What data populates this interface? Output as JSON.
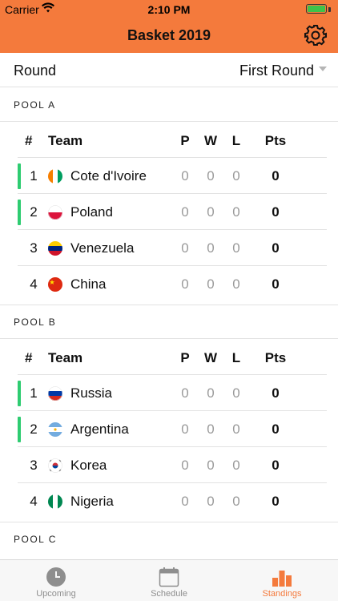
{
  "status_bar": {
    "carrier": "Carrier",
    "time": "2:10 PM",
    "battery_level": 1.0
  },
  "app": {
    "title": "Basket 2019"
  },
  "round": {
    "label": "Round",
    "value": "First Round"
  },
  "table_headers": {
    "rank": "#",
    "team": "Team",
    "played": "P",
    "won": "W",
    "lost": "L",
    "points": "Pts"
  },
  "pools": [
    {
      "name": "POOL A",
      "teams": [
        {
          "rank": "1",
          "name": "Cote d'Ivoire",
          "p": "0",
          "w": "0",
          "l": "0",
          "pts": "0",
          "qualified": true
        },
        {
          "rank": "2",
          "name": "Poland",
          "p": "0",
          "w": "0",
          "l": "0",
          "pts": "0",
          "qualified": true
        },
        {
          "rank": "3",
          "name": "Venezuela",
          "p": "0",
          "w": "0",
          "l": "0",
          "pts": "0",
          "qualified": false
        },
        {
          "rank": "4",
          "name": "China",
          "p": "0",
          "w": "0",
          "l": "0",
          "pts": "0",
          "qualified": false
        }
      ]
    },
    {
      "name": "POOL B",
      "teams": [
        {
          "rank": "1",
          "name": "Russia",
          "p": "0",
          "w": "0",
          "l": "0",
          "pts": "0",
          "qualified": true
        },
        {
          "rank": "2",
          "name": "Argentina",
          "p": "0",
          "w": "0",
          "l": "0",
          "pts": "0",
          "qualified": true
        },
        {
          "rank": "3",
          "name": "Korea",
          "p": "0",
          "w": "0",
          "l": "0",
          "pts": "0",
          "qualified": false
        },
        {
          "rank": "4",
          "name": "Nigeria",
          "p": "0",
          "w": "0",
          "l": "0",
          "pts": "0",
          "qualified": false
        }
      ]
    },
    {
      "name": "POOL C",
      "teams": []
    }
  ],
  "tabs": [
    {
      "label": "Upcoming",
      "icon": "clock-icon",
      "active": false
    },
    {
      "label": "Schedule",
      "icon": "calendar-icon",
      "active": false
    },
    {
      "label": "Standings",
      "icon": "bar-chart-icon",
      "active": true
    }
  ],
  "colors": {
    "accent": "#f47a3c",
    "qualified": "#2ecc71",
    "muted": "#8e8e8e"
  }
}
